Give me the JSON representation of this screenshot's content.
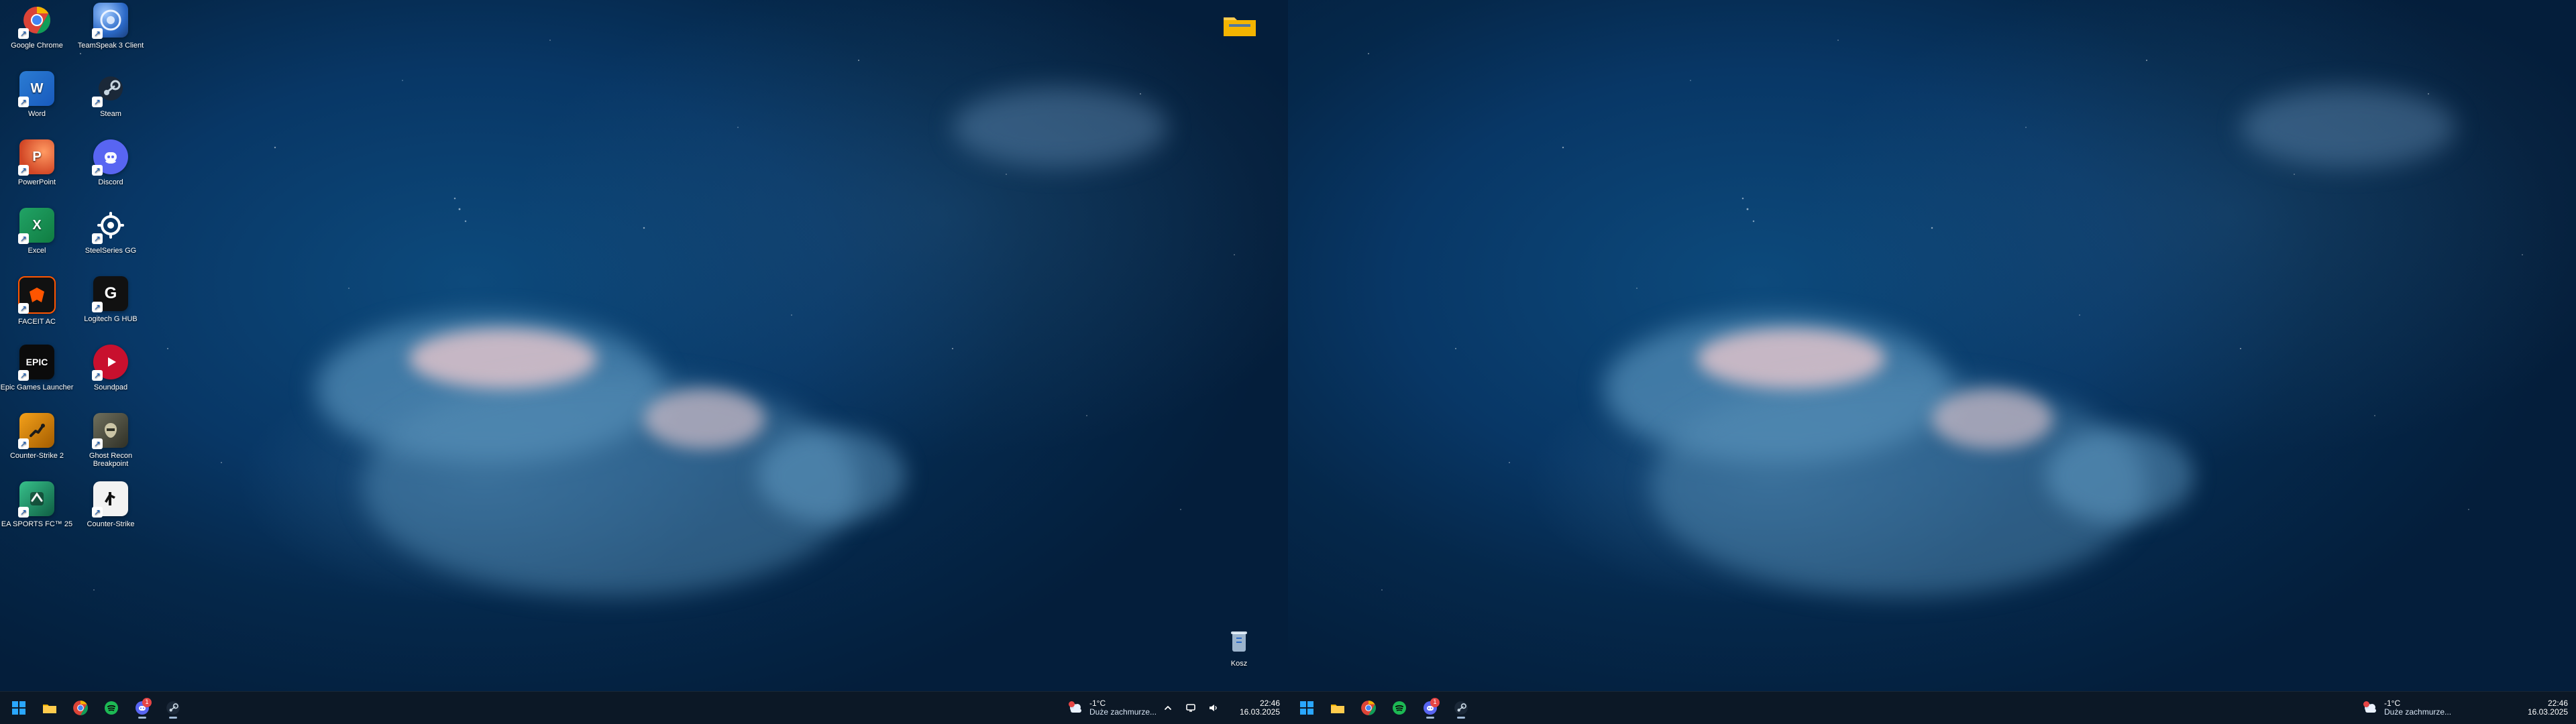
{
  "desktop_icons": [
    {
      "label": "Google Chrome",
      "icon": "chrome-icon"
    },
    {
      "label": "TeamSpeak 3 Client",
      "icon": "teamspeak-icon"
    },
    {
      "label": "Word",
      "icon": "word-icon"
    },
    {
      "label": "Steam",
      "icon": "steam-icon"
    },
    {
      "label": "PowerPoint",
      "icon": "powerpoint-icon"
    },
    {
      "label": "Discord",
      "icon": "discord-icon"
    },
    {
      "label": "Excel",
      "icon": "excel-icon"
    },
    {
      "label": "SteelSeries GG",
      "icon": "steelseries-icon"
    },
    {
      "label": "FACEIT AC",
      "icon": "faceit-icon"
    },
    {
      "label": "Logitech G HUB",
      "icon": "logitech-icon"
    },
    {
      "label": "Epic Games Launcher",
      "icon": "epic-icon"
    },
    {
      "label": "Soundpad",
      "icon": "soundpad-icon"
    },
    {
      "label": "Counter-Strike 2",
      "icon": "cs2-icon"
    },
    {
      "label": "Ghost Recon Breakpoint",
      "icon": "ghost-recon-icon"
    },
    {
      "label": "EA SPORTS FC™ 25",
      "icon": "ea-fc-icon"
    },
    {
      "label": "Counter-Strike",
      "icon": "counter-strike-icon"
    }
  ],
  "desktop_right_items": {
    "top_right_folder_icon": "folder-icon",
    "trash_label": "Kosz",
    "trash_icon": "recycle-bin-icon"
  },
  "taskbar": {
    "pinned_icons": [
      {
        "name": "start-icon"
      },
      {
        "name": "file-explorer-icon"
      },
      {
        "name": "chrome-icon"
      },
      {
        "name": "spotify-icon"
      },
      {
        "name": "discord-icon",
        "badge": "1"
      },
      {
        "name": "steam-icon"
      }
    ],
    "weather": {
      "temp": "-1°C",
      "condition": "Duże zachmurze..."
    },
    "tray": {
      "icons": [
        "chevron-up-icon",
        "network-icon",
        "volume-icon"
      ]
    },
    "clock": {
      "time": "22:46",
      "date": "16.03.2025"
    }
  },
  "colors": {
    "taskbar_bg": "#0e1824",
    "accent_blue": "#1b5fb6",
    "badge_red": "#e64545"
  }
}
